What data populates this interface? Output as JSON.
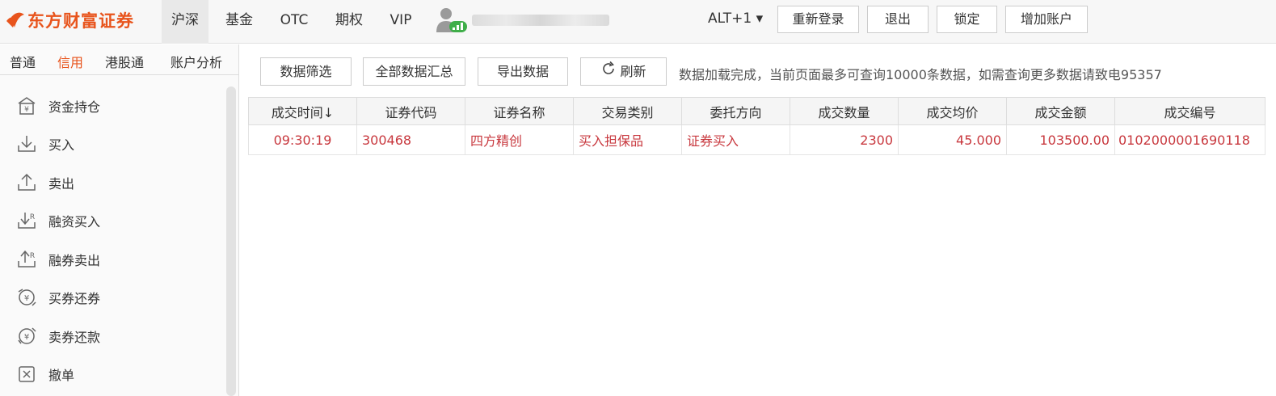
{
  "app": {
    "brand": "东方财富证券"
  },
  "market_tabs": [
    "沪深",
    "基金",
    "OTC",
    "期权",
    "VIP"
  ],
  "header": {
    "alt_label": "ALT+1 ▾",
    "buttons": {
      "relogin": "重新登录",
      "logout": "退出",
      "lock": "锁定",
      "add_account": "增加账户"
    }
  },
  "sidebar": {
    "tabs": [
      "普通",
      "信用",
      "港股通",
      "账户分析"
    ],
    "items": [
      "资金持仓",
      "买入",
      "卖出",
      "融资买入",
      "融券卖出",
      "买券还券",
      "卖券还款",
      "撤单"
    ]
  },
  "toolbar": {
    "filter": "数据筛选",
    "summary": "全部数据汇总",
    "export": "导出数据",
    "refresh": "刷新",
    "notice": "数据加载完成，当前页面最多可查询10000条数据，如需查询更多数据请致电95357"
  },
  "table": {
    "headers": [
      "成交时间↓",
      "证券代码",
      "证券名称",
      "交易类别",
      "委托方向",
      "成交数量",
      "成交均价",
      "成交金额",
      "成交编号"
    ],
    "rows": [
      [
        "09:30:19",
        "300468",
        "四方精创",
        "买入担保品",
        "证券买入",
        "2300",
        "45.000",
        "103500.00",
        "0102000001690118"
      ]
    ]
  },
  "colors": {
    "accent": "#e8541c",
    "row_text": "#c8383e",
    "online": "#3fae49"
  }
}
